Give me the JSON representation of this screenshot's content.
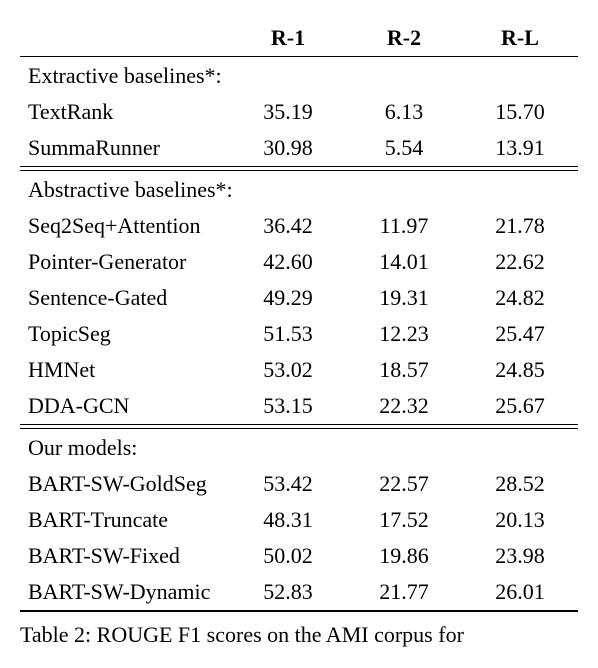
{
  "headers": {
    "blank": "",
    "r1": "R-1",
    "r2": "R-2",
    "rl": "R-L"
  },
  "sections": [
    {
      "title": "Extractive baselines*:",
      "rows": [
        {
          "name": "TextRank",
          "r1": "35.19",
          "r2": "6.13",
          "rl": "15.70"
        },
        {
          "name": "SummaRunner",
          "r1": "30.98",
          "r2": "5.54",
          "rl": "13.91"
        }
      ]
    },
    {
      "title": "Abstractive baselines*:",
      "rows": [
        {
          "name": "Seq2Seq+Attention",
          "r1": "36.42",
          "r2": "11.97",
          "rl": "21.78"
        },
        {
          "name": "Pointer-Generator",
          "r1": "42.60",
          "r2": "14.01",
          "rl": "22.62"
        },
        {
          "name": "Sentence-Gated",
          "r1": "49.29",
          "r2": "19.31",
          "rl": "24.82"
        },
        {
          "name": "TopicSeg",
          "r1": "51.53",
          "r2": "12.23",
          "rl": "25.47"
        },
        {
          "name": "HMNet",
          "r1": "53.02",
          "r2": "18.57",
          "rl": "24.85"
        },
        {
          "name": "DDA-GCN",
          "r1": "53.15",
          "r2": "22.32",
          "rl": "25.67"
        }
      ]
    },
    {
      "title": "Our models:",
      "rows": [
        {
          "name": "BART-SW-GoldSeg",
          "r1": "53.42",
          "r2": "22.57",
          "rl": "28.52"
        },
        {
          "name": "BART-Truncate",
          "r1": "48.31",
          "r2": "17.52",
          "rl": "20.13"
        },
        {
          "name": "BART-SW-Fixed",
          "r1": "50.02",
          "r2": "19.86",
          "rl": "23.98"
        },
        {
          "name": "BART-SW-Dynamic",
          "r1": "52.83",
          "r2": "21.77",
          "rl": "26.01"
        }
      ]
    }
  ],
  "caption": "Table 2:  ROUGE F1 scores on the AMI corpus for"
}
